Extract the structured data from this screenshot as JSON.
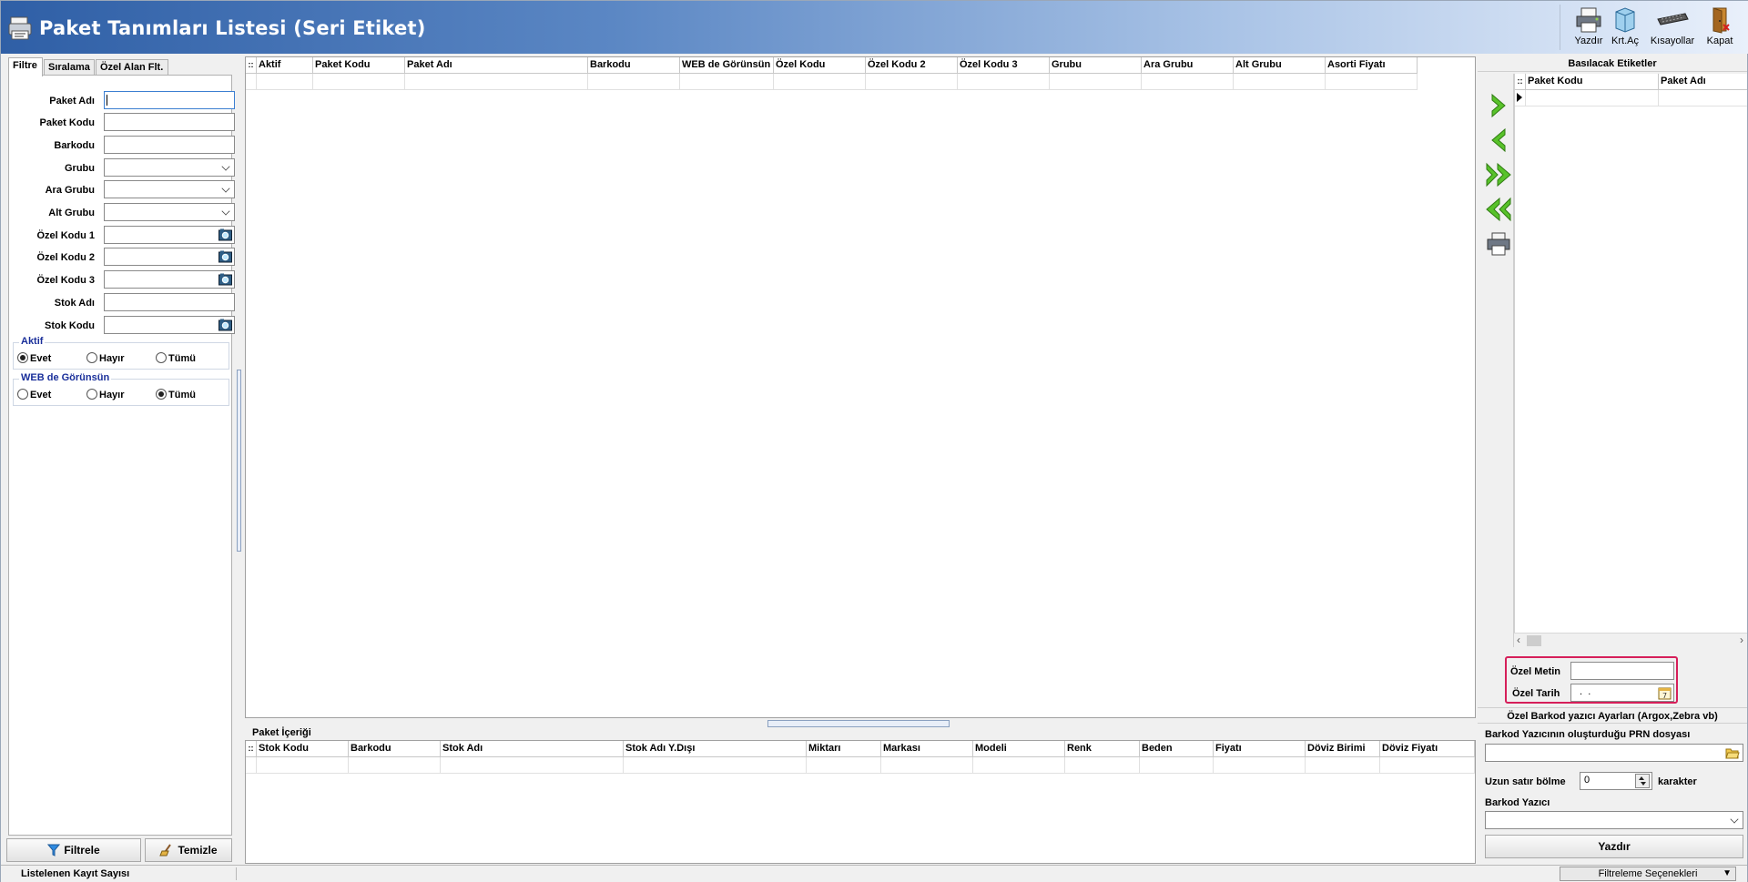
{
  "window": {
    "title": "Paket Tanımları Listesi (Seri Etiket)"
  },
  "toolbar": {
    "yazdir": "Yazdır",
    "krtac": "Krt.Aç",
    "kisayollar": "Kısayollar",
    "kapat": "Kapat"
  },
  "filter_panel": {
    "tabs": [
      "Filtre",
      "Sıralama",
      "Özel Alan Flt."
    ],
    "fields": {
      "paket_adi": "Paket Adı",
      "paket_kodu": "Paket Kodu",
      "barkodu": "Barkodu",
      "grubu": "Grubu",
      "ara_grubu": "Ara Grubu",
      "alt_grubu": "Alt Grubu",
      "ozel_kodu_1": "Özel Kodu 1",
      "ozel_kodu_2": "Özel Kodu 2",
      "ozel_kodu_3": "Özel Kodu 3",
      "stok_adi": "Stok Adı",
      "stok_kodu": "Stok Kodu"
    },
    "aktif_group": {
      "title": "Aktif",
      "options": [
        "Evet",
        "Hayır",
        "Tümü"
      ],
      "selected": "Evet"
    },
    "web_group": {
      "title": "WEB de Görünsün",
      "options": [
        "Evet",
        "Hayır",
        "Tümü"
      ],
      "selected": "Tümü"
    },
    "filtrele_label": "Filtrele",
    "temizle_label": "Temizle"
  },
  "main_grid": {
    "columns": [
      "Aktif",
      "Paket Kodu",
      "Paket Adı",
      "Barkodu",
      "WEB de Görünsün",
      "Özel Kodu",
      "Özel Kodu 2",
      "Özel Kodu 3",
      "Grubu",
      "Ara Grubu",
      "Alt Grubu",
      "Asorti Fiyatı"
    ]
  },
  "paket_icerigi": {
    "title": "Paket İçeriği",
    "columns": [
      "Stok Kodu",
      "Barkodu",
      "Stok Adı",
      "Stok Adı Y.Dışı",
      "Miktarı",
      "Markası",
      "Modeli",
      "Renk",
      "Beden",
      "Fiyatı",
      "Döviz Birimi",
      "Döviz Fiyatı"
    ]
  },
  "right_panel": {
    "title": "Basılacak Etiketler",
    "columns": [
      "Paket Kodu",
      "Paket Adı"
    ],
    "ozel_metin_label": "Özel Metin",
    "ozel_tarih_label": "Özel Tarih",
    "ozel_tarih_value": " .  .",
    "barkod_section_title": "Özel Barkod yazıcı Ayarları (Argox,Zebra vb)",
    "prn_label": "Barkod Yazıcının oluşturduğu PRN dosyası",
    "uzun_satir_label": "Uzun satır bölme",
    "uzun_satir_value": "0",
    "karakter_label": "karakter",
    "barkod_yazici_label": "Barkod Yazıcı",
    "yazdir_label": "Yazdır"
  },
  "status": {
    "kayit_label": "Listelenen Kayıt Sayısı",
    "filtreleme_label": "Filtreleme Seçenekleri"
  }
}
